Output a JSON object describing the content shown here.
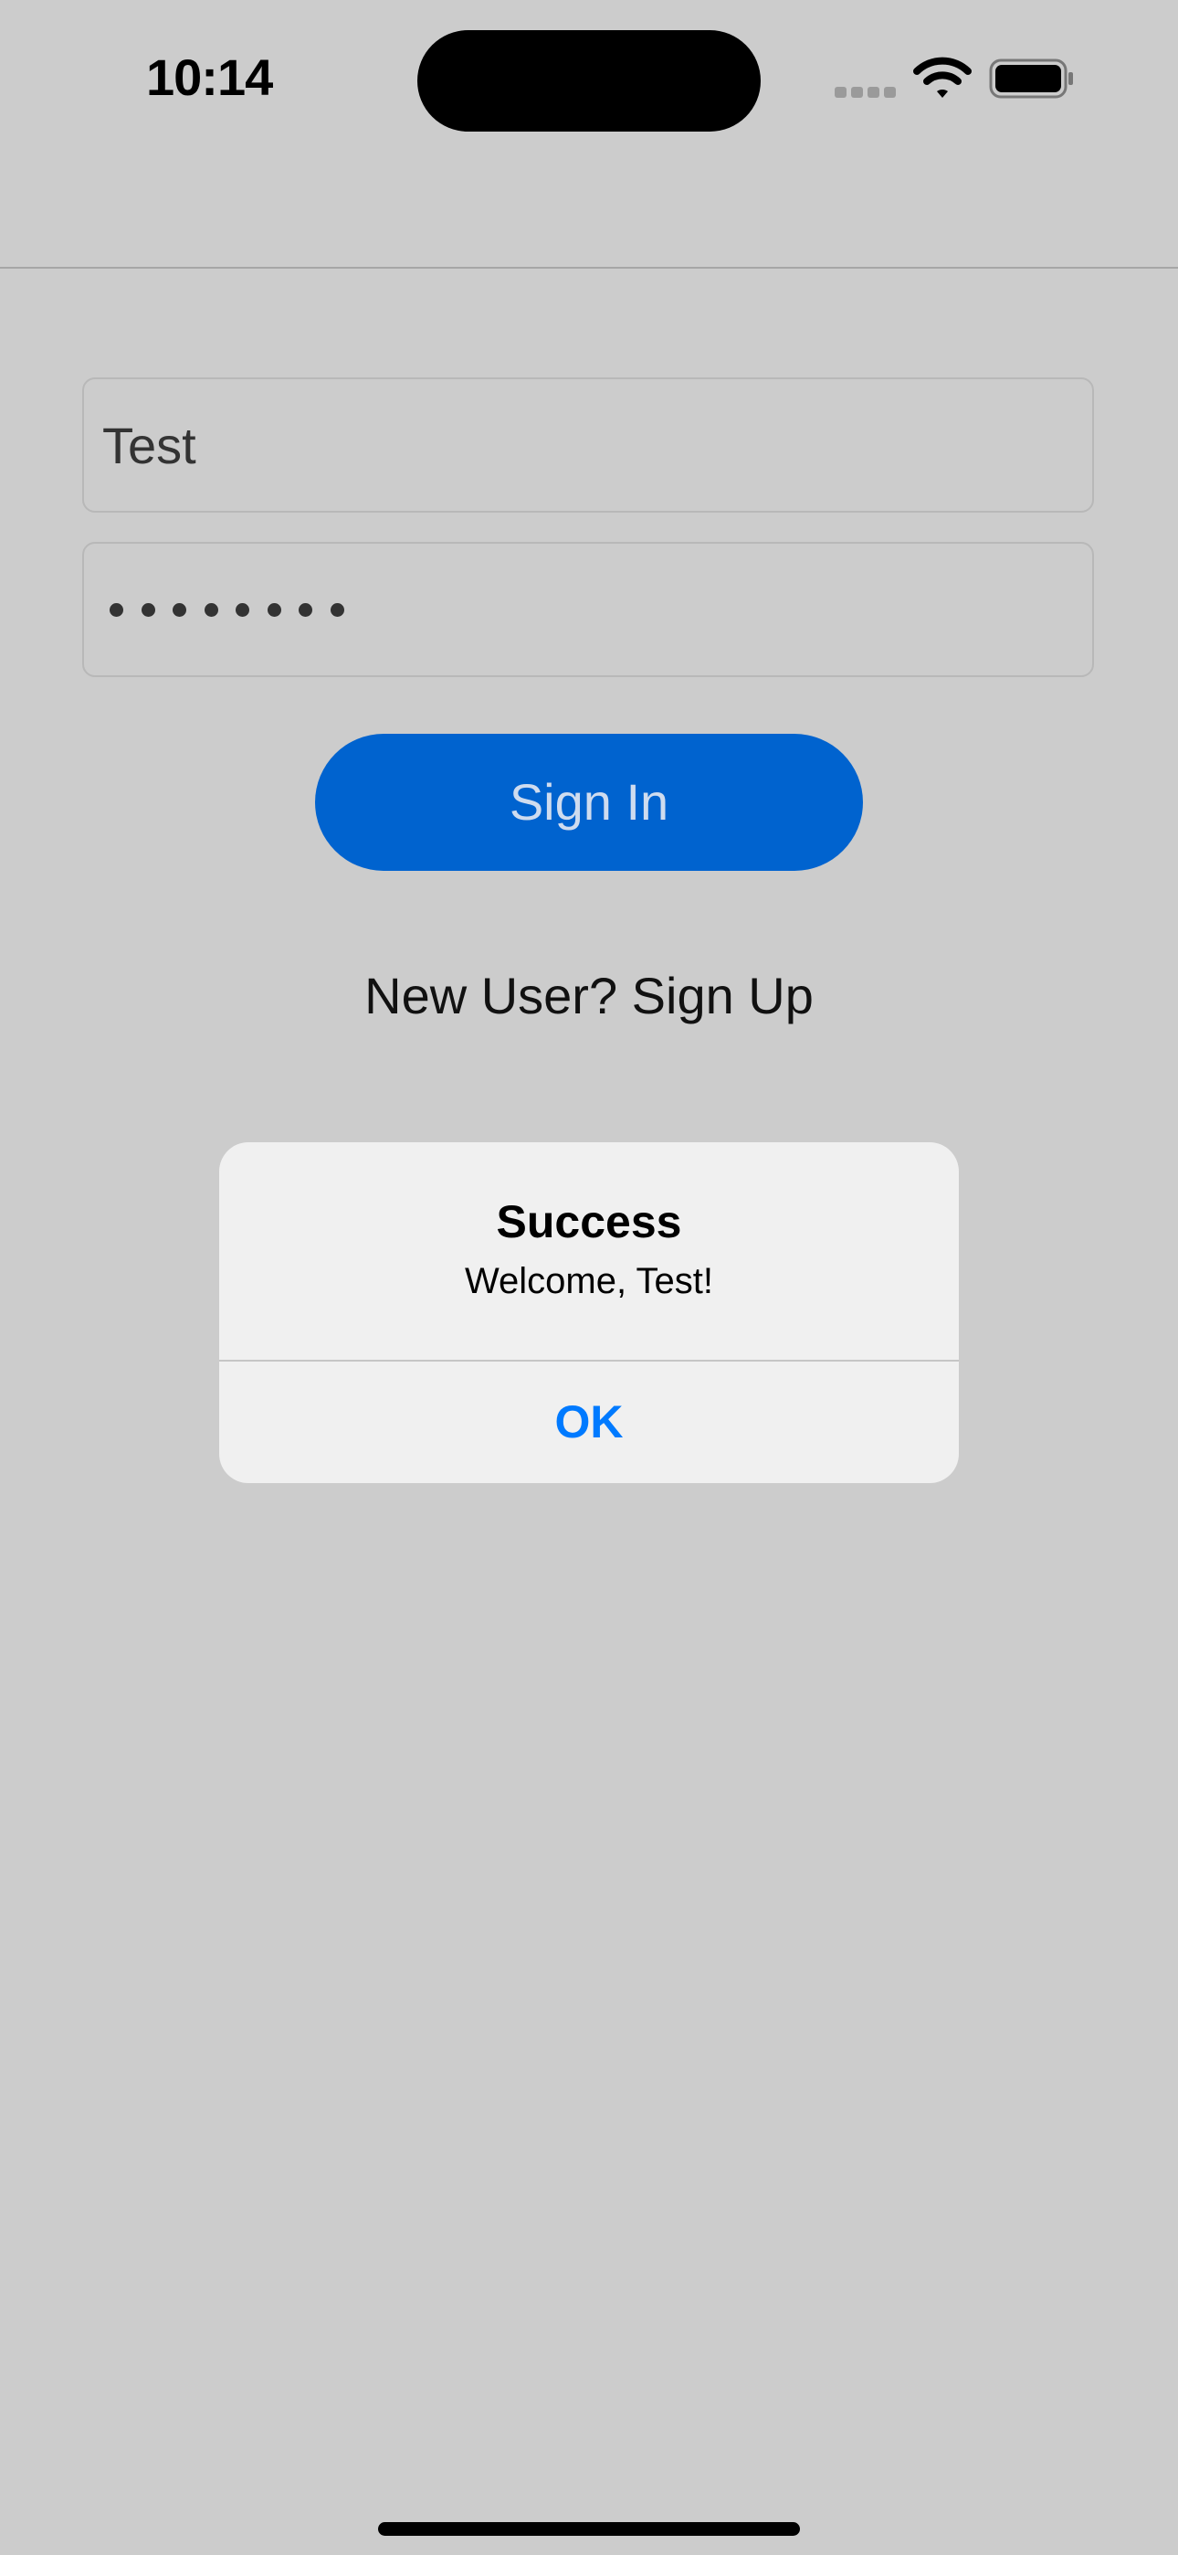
{
  "status_bar": {
    "time": "10:14",
    "icons": [
      "cellular-signal-icon",
      "wifi-icon",
      "battery-icon"
    ]
  },
  "form": {
    "username_value": "Test",
    "password_masked": "••••••••",
    "password_length": 8
  },
  "buttons": {
    "sign_in_label": "Sign In",
    "sign_up_link": "New User? Sign Up"
  },
  "alert": {
    "title": "Success",
    "message": "Welcome, Test!",
    "ok_label": "OK"
  },
  "colors": {
    "background": "#cccccc",
    "primary_button": "#0063cf",
    "primary_button_text": "#cfdcef",
    "alert_background": "#f0f0f0",
    "alert_action": "#007aff"
  }
}
